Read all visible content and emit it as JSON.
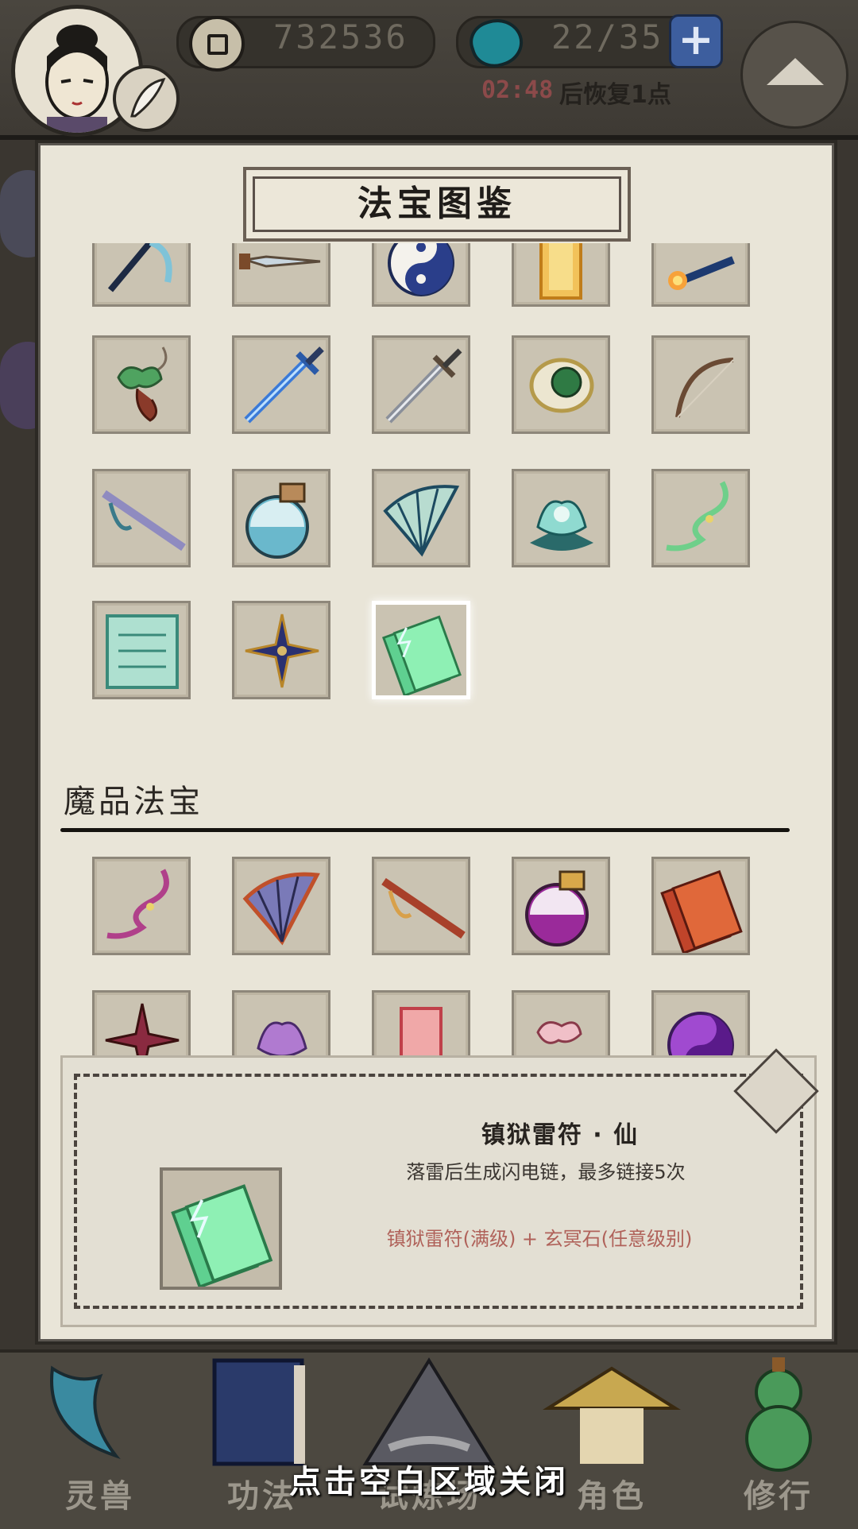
{
  "header": {
    "currency_value": "732536",
    "stamina_value": "22/35",
    "recover_timer": "02:48",
    "recover_label": "后恢复1点",
    "add_symbol": "+"
  },
  "modal": {
    "title": "法宝图鉴",
    "section_demon": "魔品法宝",
    "immortal_items": [
      {
        "icon": "blue-whip-icon"
      },
      {
        "icon": "dagger-icon"
      },
      {
        "icon": "taiji-icon"
      },
      {
        "icon": "golden-talisman-icon"
      },
      {
        "icon": "fire-staff-icon"
      },
      {
        "icon": "jade-knot-pendant-icon"
      },
      {
        "icon": "blue-sword-icon"
      },
      {
        "icon": "steel-sword-icon"
      },
      {
        "icon": "jade-ring-icon"
      },
      {
        "icon": "bow-icon"
      },
      {
        "icon": "flute-icon"
      },
      {
        "icon": "gourd-bottle-icon"
      },
      {
        "icon": "folding-fan-icon"
      },
      {
        "icon": "lotus-icon"
      },
      {
        "icon": "jade-cord-icon"
      },
      {
        "icon": "scroll-icon"
      },
      {
        "icon": "shuriken-icon"
      },
      {
        "icon": "thunder-talisman-icon"
      }
    ],
    "demon_items": [
      {
        "icon": "purple-cord-icon"
      },
      {
        "icon": "red-fan-icon"
      },
      {
        "icon": "red-flute-icon"
      },
      {
        "icon": "purple-gourd-icon"
      },
      {
        "icon": "red-talisman-icon"
      },
      {
        "icon": "red-shuriken-icon"
      },
      {
        "icon": "purple-lotus-icon"
      },
      {
        "icon": "red-plaque-icon"
      },
      {
        "icon": "pink-knot-icon"
      },
      {
        "icon": "purple-taiji-icon"
      }
    ],
    "selected_index": 17
  },
  "detail": {
    "name": "镇狱雷符 · 仙",
    "description": "落雷后生成闪电链，最多链接5次",
    "recipe": "镇狱雷符(满级)  +  玄冥石(任意级别)"
  },
  "bottom_nav": [
    {
      "label": "灵兽",
      "icon": "feather-icon"
    },
    {
      "label": "功法",
      "icon": "book-icon"
    },
    {
      "label": "试炼场",
      "icon": "mountain-icon"
    },
    {
      "label": "角色",
      "icon": "straw-hat-icon"
    },
    {
      "label": "修行",
      "icon": "gourd-icon"
    }
  ],
  "close_hint": "点击空白区域关闭",
  "colors": {
    "modal_bg": "#e9e5d8",
    "slot_bg": "#cac3b2",
    "recipe_text": "#b0625a",
    "timer_text": "#8c4a4a",
    "plus_button": "#3d5e9e"
  }
}
